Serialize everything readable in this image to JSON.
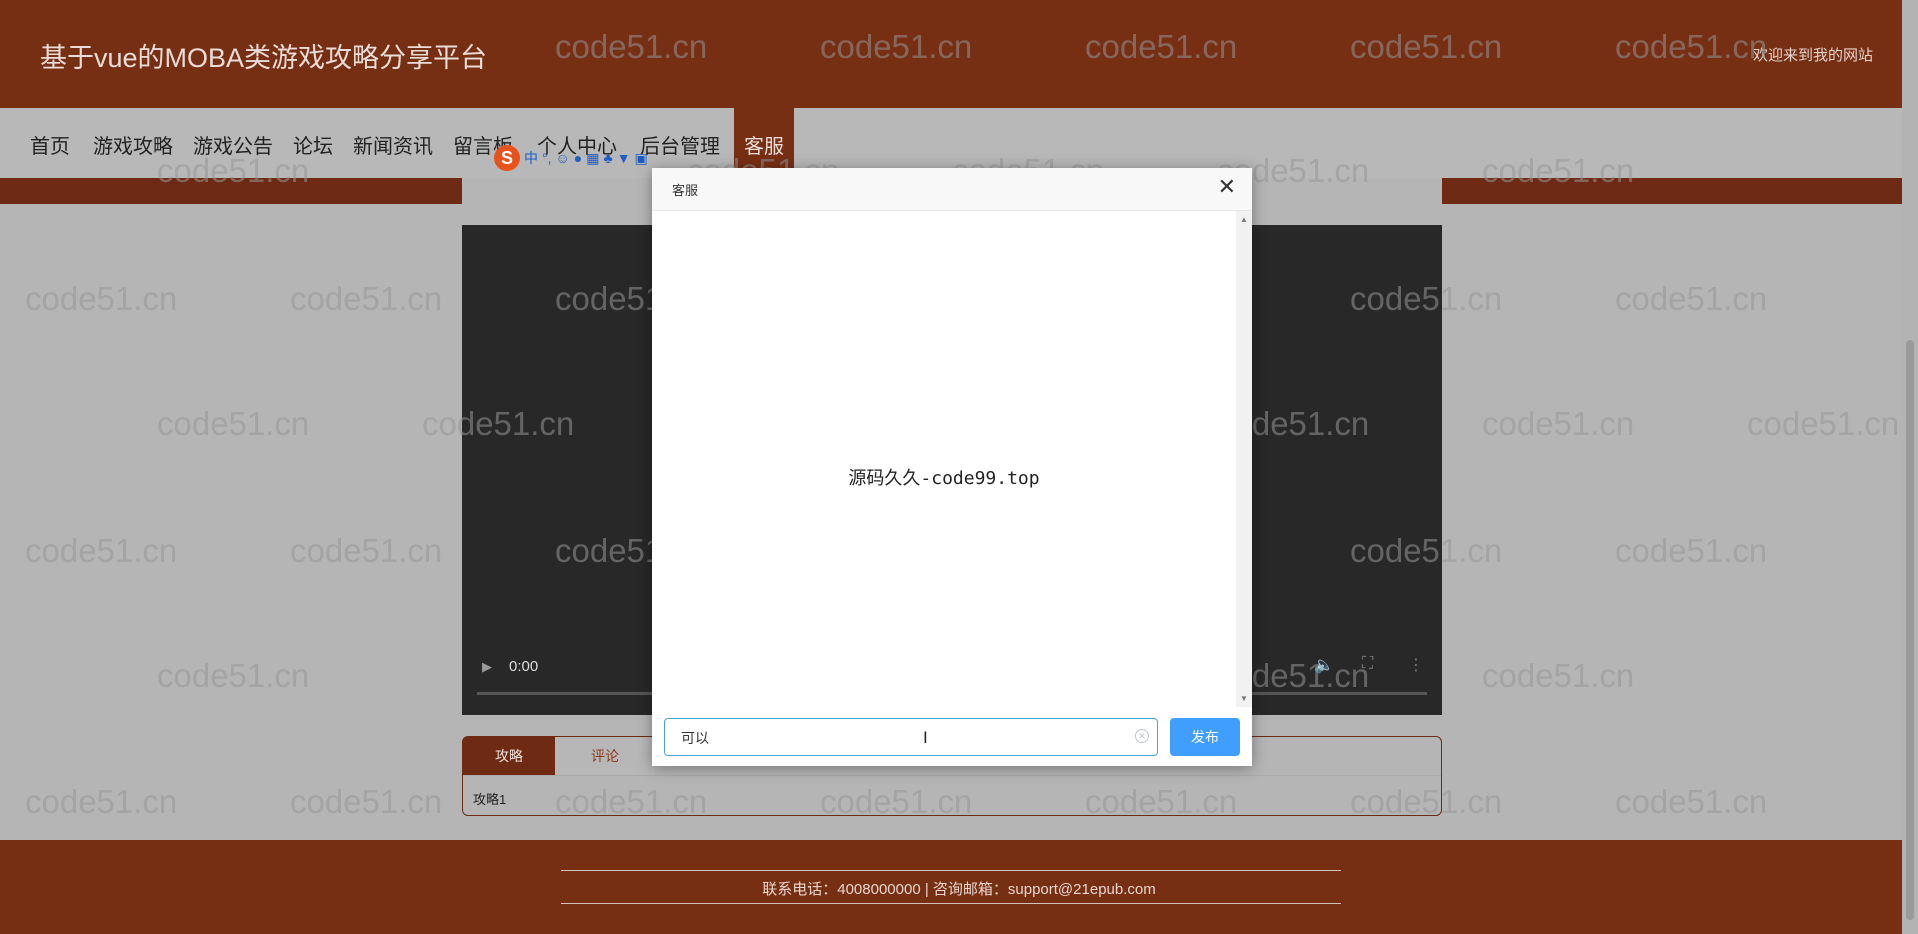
{
  "header": {
    "site_title": "基于vue的MOBA类游戏攻略分享平台",
    "welcome": "欢迎来到我的网站"
  },
  "nav": {
    "items": [
      "首页",
      "游戏攻略",
      "游戏公告",
      "论坛",
      "新闻资讯",
      "留言板",
      "个人中心",
      "后台管理",
      "客服"
    ],
    "active": "客服"
  },
  "video": {
    "time": "0:00"
  },
  "detail_tabs": {
    "tabs": [
      "攻略",
      "评论"
    ],
    "active": "攻略",
    "content": "攻略1"
  },
  "modal": {
    "title": "客服",
    "message": "源码久久-code99.top",
    "input_value": "可以",
    "send_label": "发布"
  },
  "footer": {
    "contact": "联系电话：4008000000 | 咨询邮箱：support@21epub.com"
  },
  "watermark": "code51.cn",
  "colors": {
    "brand_brown": "#772f14",
    "send_button": "#409eff",
    "page_overlay": "#b5b5b5"
  }
}
